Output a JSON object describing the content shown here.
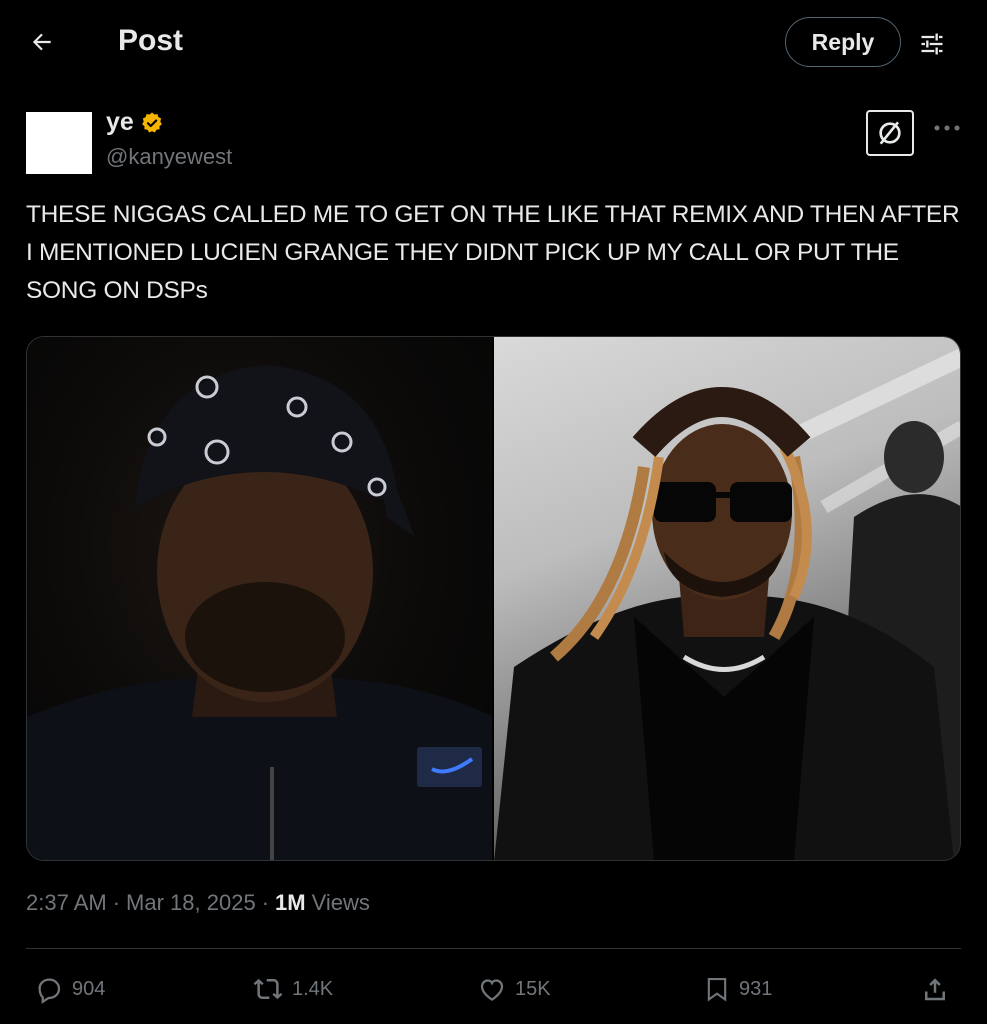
{
  "header": {
    "title": "Post",
    "reply_label": "Reply"
  },
  "author": {
    "display_name": "ye",
    "handle": "@kanyewest",
    "verified": true,
    "verified_color": "#f4b400"
  },
  "post": {
    "text": "THESE NIGGAS CALLED ME TO GET ON THE LIKE THAT REMIX AND THEN AFTER I MENTIONED LUCIEN GRANGE THEY DIDNT PICK UP MY CALL OR PUT THE SONG ON DSPs",
    "time": "2:37 AM",
    "date": "Mar 18, 2025",
    "views_count": "1M",
    "views_label": "Views"
  },
  "actions": {
    "replies": "904",
    "reposts": "1.4K",
    "likes": "15K",
    "bookmarks": "931"
  },
  "colors": {
    "background": "#000000",
    "text": "#e7e9ea",
    "muted": "#71767b",
    "border": "#2f3336"
  },
  "icons": [
    "back-arrow-icon",
    "filter-icon",
    "verified-badge-icon",
    "grok-icon",
    "more-icon",
    "reply-icon",
    "repost-icon",
    "like-icon",
    "bookmark-icon",
    "share-icon"
  ]
}
